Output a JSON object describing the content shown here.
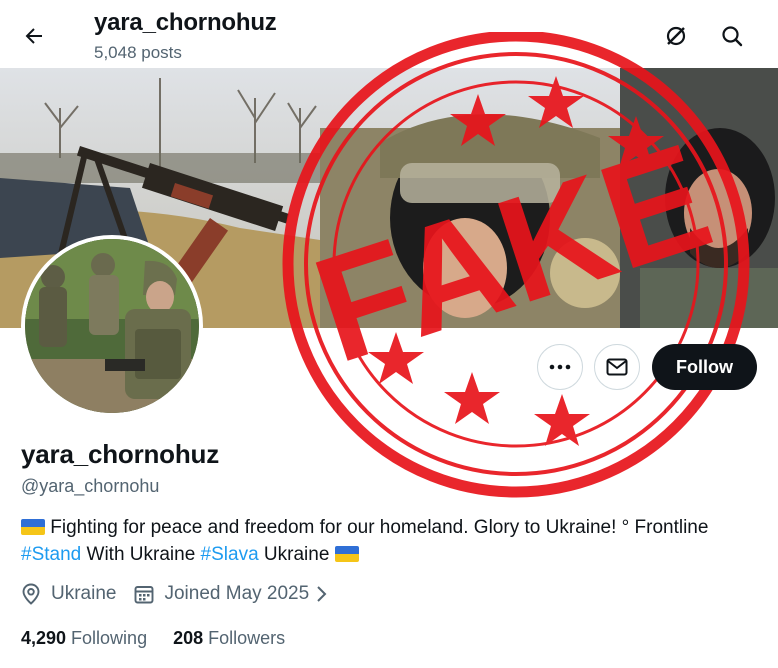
{
  "header": {
    "title": "yara_chornohuz",
    "posts": "5,048 posts",
    "back_icon": "arrow-left-icon",
    "grok_icon": "grok-icon",
    "search_icon": "search-icon"
  },
  "profile": {
    "display_name": "yara_chornohuz",
    "handle": "@yara_chornohu",
    "bio": {
      "line1_text": "Fighting for peace and freedom for our homeland. Glory to Ukraine! ° Frontline",
      "hashtag1": "#Stand",
      "mid_text": " With Ukraine ",
      "hashtag2": "#Slava",
      "end_text": " Ukraine "
    },
    "location": "Ukraine",
    "joined": "Joined May 2025",
    "following_count": "4,290",
    "following_label": "Following",
    "followers_count": "208",
    "followers_label": "Followers"
  },
  "actions": {
    "more_icon": "more-dots-icon",
    "message_icon": "envelope-icon",
    "follow_label": "Follow"
  },
  "stamp": {
    "text": "FAKE",
    "color": "#e8141b"
  },
  "colors": {
    "accent": "#1d9bf0",
    "text": "#0f1419",
    "secondary": "#536471",
    "flag_blue": "#2f6fd6",
    "flag_yellow": "#f5c518"
  }
}
